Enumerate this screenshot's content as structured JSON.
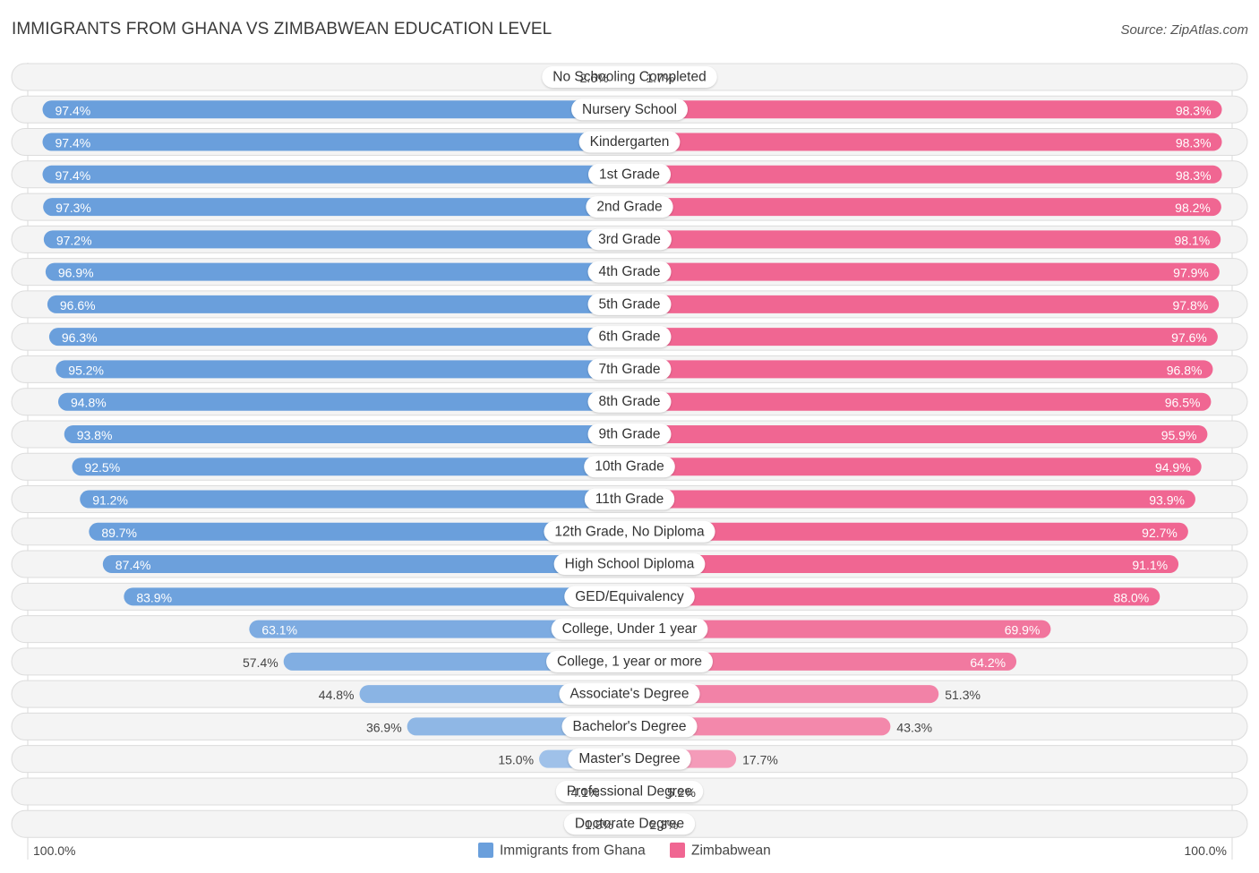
{
  "header": {
    "title": "IMMIGRANTS FROM GHANA VS ZIMBABWEAN EDUCATION LEVEL",
    "source": "Source: ZipAtlas.com"
  },
  "chart_data": {
    "type": "bar",
    "orientation": "horizontal-diverging",
    "title": "IMMIGRANTS FROM GHANA VS ZIMBABWEAN EDUCATION LEVEL",
    "xlabel": "",
    "ylabel": "",
    "xlim": [
      0,
      100
    ],
    "axis_left_label": "100.0%",
    "axis_right_label": "100.0%",
    "legend_position": "bottom-center",
    "categories": [
      "No Schooling Completed",
      "Nursery School",
      "Kindergarten",
      "1st Grade",
      "2nd Grade",
      "3rd Grade",
      "4th Grade",
      "5th Grade",
      "6th Grade",
      "7th Grade",
      "8th Grade",
      "9th Grade",
      "10th Grade",
      "11th Grade",
      "12th Grade, No Diploma",
      "High School Diploma",
      "GED/Equivalency",
      "College, Under 1 year",
      "College, 1 year or more",
      "Associate's Degree",
      "Bachelor's Degree",
      "Master's Degree",
      "Professional Degree",
      "Doctorate Degree"
    ],
    "series": [
      {
        "name": "Immigrants from Ghana",
        "side": "left",
        "color": "#6a9fdc",
        "color_light": "#a9c8ec",
        "values": [
          2.6,
          97.4,
          97.4,
          97.4,
          97.3,
          97.2,
          96.9,
          96.6,
          96.3,
          95.2,
          94.8,
          93.8,
          92.5,
          91.2,
          89.7,
          87.4,
          83.9,
          63.1,
          57.4,
          44.8,
          36.9,
          15.0,
          4.1,
          1.8
        ],
        "labels": [
          "2.6%",
          "97.4%",
          "97.4%",
          "97.4%",
          "97.3%",
          "97.2%",
          "96.9%",
          "96.6%",
          "96.3%",
          "95.2%",
          "94.8%",
          "93.8%",
          "92.5%",
          "91.2%",
          "89.7%",
          "87.4%",
          "83.9%",
          "63.1%",
          "57.4%",
          "44.8%",
          "36.9%",
          "15.0%",
          "4.1%",
          "1.8%"
        ]
      },
      {
        "name": "Zimbabwean",
        "side": "right",
        "color": "#f06692",
        "color_light": "#f5a8c2",
        "values": [
          1.7,
          98.3,
          98.3,
          98.3,
          98.2,
          98.1,
          97.9,
          97.8,
          97.6,
          96.8,
          96.5,
          95.9,
          94.9,
          93.9,
          92.7,
          91.1,
          88.0,
          69.9,
          64.2,
          51.3,
          43.3,
          17.7,
          5.2,
          2.3
        ],
        "labels": [
          "1.7%",
          "98.3%",
          "98.3%",
          "98.3%",
          "98.2%",
          "98.1%",
          "97.9%",
          "97.8%",
          "97.6%",
          "96.8%",
          "96.5%",
          "95.9%",
          "94.9%",
          "93.9%",
          "92.7%",
          "91.1%",
          "88.0%",
          "69.9%",
          "64.2%",
          "51.3%",
          "43.3%",
          "17.7%",
          "5.2%",
          "2.3%"
        ]
      }
    ]
  },
  "legend": {
    "items": [
      {
        "label": "Immigrants from Ghana",
        "color": "#6a9fdc"
      },
      {
        "label": "Zimbabwean",
        "color": "#f06692"
      }
    ]
  }
}
